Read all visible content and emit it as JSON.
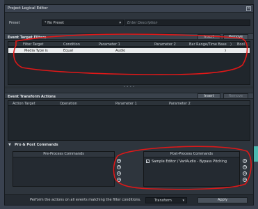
{
  "window": {
    "title": "Project Logical Editor",
    "close_glyph": "×"
  },
  "preset": {
    "label": "Preset",
    "value": "* No Preset",
    "dropdown_arrow": "▾",
    "description_placeholder": "Enter Description"
  },
  "event_target_filters": {
    "title": "Event Target Filters",
    "insert_label": "Insert",
    "remove_label": "Remove",
    "columns": [
      "Filter Target",
      "Condition",
      "Parameter 1",
      "Parameter 2",
      "Bar Range/Time Base",
      ")",
      "Bool"
    ],
    "rows": [
      {
        "target": "Media Type is",
        "condition": "Equal",
        "param1": "Audio",
        "param2": "",
        "bar_range": "",
        "paren": ")",
        "bool": ""
      }
    ]
  },
  "splitter_dots": "• • • •",
  "event_transform_actions": {
    "title": "Event Transform Actions",
    "insert_label": "Insert",
    "remove_label": "Remove",
    "columns": [
      "Action Target",
      "Operation",
      "Parameter 1",
      "Parameter 2"
    ]
  },
  "pre_post": {
    "title": "Pro & Post Commands",
    "collapse_glyph": "▼",
    "pre_title": "Pre-Process Commands",
    "post_title": "Post-Process Commands",
    "post_items": [
      {
        "checked": true,
        "check_glyph": "✓",
        "label": "Sample Editor / VariAudio - Bypass Pitching"
      }
    ],
    "add_glyph": "+",
    "remove_glyph": "×"
  },
  "footer": {
    "instruction": "Perform the actions on all events matching the filter conditions.",
    "function_value": "Transform",
    "function_arrow": "▾",
    "apply_label": "Apply"
  },
  "colors": {
    "annotation_red": "#e01818",
    "accent_teal": "#4ab8b0"
  }
}
